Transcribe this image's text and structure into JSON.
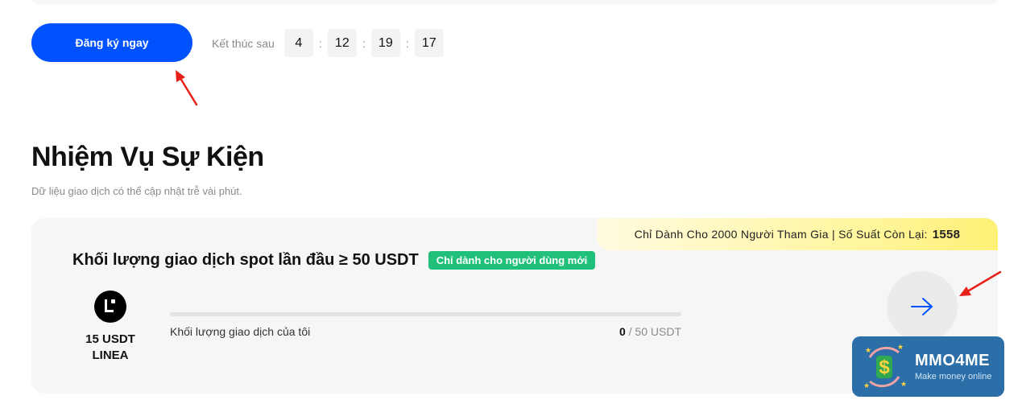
{
  "register": {
    "label": "Đăng ký ngay"
  },
  "countdown": {
    "label": "Kết thúc sau",
    "days": "4",
    "hours": "12",
    "minutes": "19",
    "seconds": "17",
    "separator": ":"
  },
  "section": {
    "title": "Nhiệm Vụ Sự Kiện",
    "subtitle": "Dữ liệu giao dịch có thể cập nhật trễ vài phút."
  },
  "task": {
    "quota_text": "Chỉ Dành Cho 2000 Người Tham Gia | Số Suất Còn Lại:",
    "quota_remaining": "1558",
    "title": "Khối lượng giao dịch spot lần đầu ≥ 50 USDT",
    "badge": "Chỉ dành cho người dùng mới",
    "reward_amount": "15 USDT",
    "reward_token": "LINEA",
    "progress_label": "Khối lượng giao dịch của tôi",
    "progress_current": "0",
    "progress_total": " / 50 USDT",
    "progress_fraction": 0
  },
  "watermark": {
    "title": "MMO4ME",
    "subtitle": "Make money online"
  },
  "colors": {
    "primary": "#0052ff",
    "badge_green": "#20c07a",
    "banner_yellow": "#fff59a",
    "annotation_red": "#e8201a"
  }
}
